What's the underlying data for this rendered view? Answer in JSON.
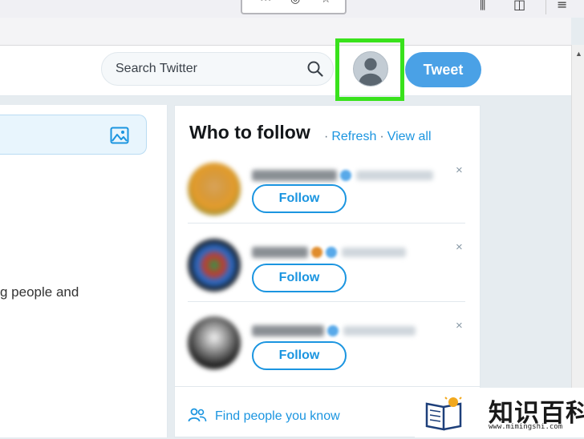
{
  "browser": {
    "toolbar_icons": [
      "more-icon",
      "pocket-icon",
      "bookmark-star-icon"
    ],
    "right_icons": [
      "library-icon",
      "sidebar-icon",
      "menu-icon"
    ]
  },
  "header": {
    "search_placeholder": "Search Twitter",
    "tweet_label": "Tweet",
    "accent": "#1b95e0",
    "tweet_bg": "#4aa1e6",
    "highlight_color": "#39e21c"
  },
  "compose": {
    "partial_text": "g people and"
  },
  "who_to_follow": {
    "title": "Who to follow",
    "refresh": "Refresh",
    "view_all": "View all",
    "separator": "·",
    "items": [
      {
        "follow_label": "Follow",
        "close": "×"
      },
      {
        "follow_label": "Follow",
        "close": "×"
      },
      {
        "follow_label": "Follow",
        "close": "×"
      }
    ],
    "find_people": "Find people you know"
  },
  "watermark": {
    "text": "知识百科",
    "url": "www.mimingshi.com"
  }
}
